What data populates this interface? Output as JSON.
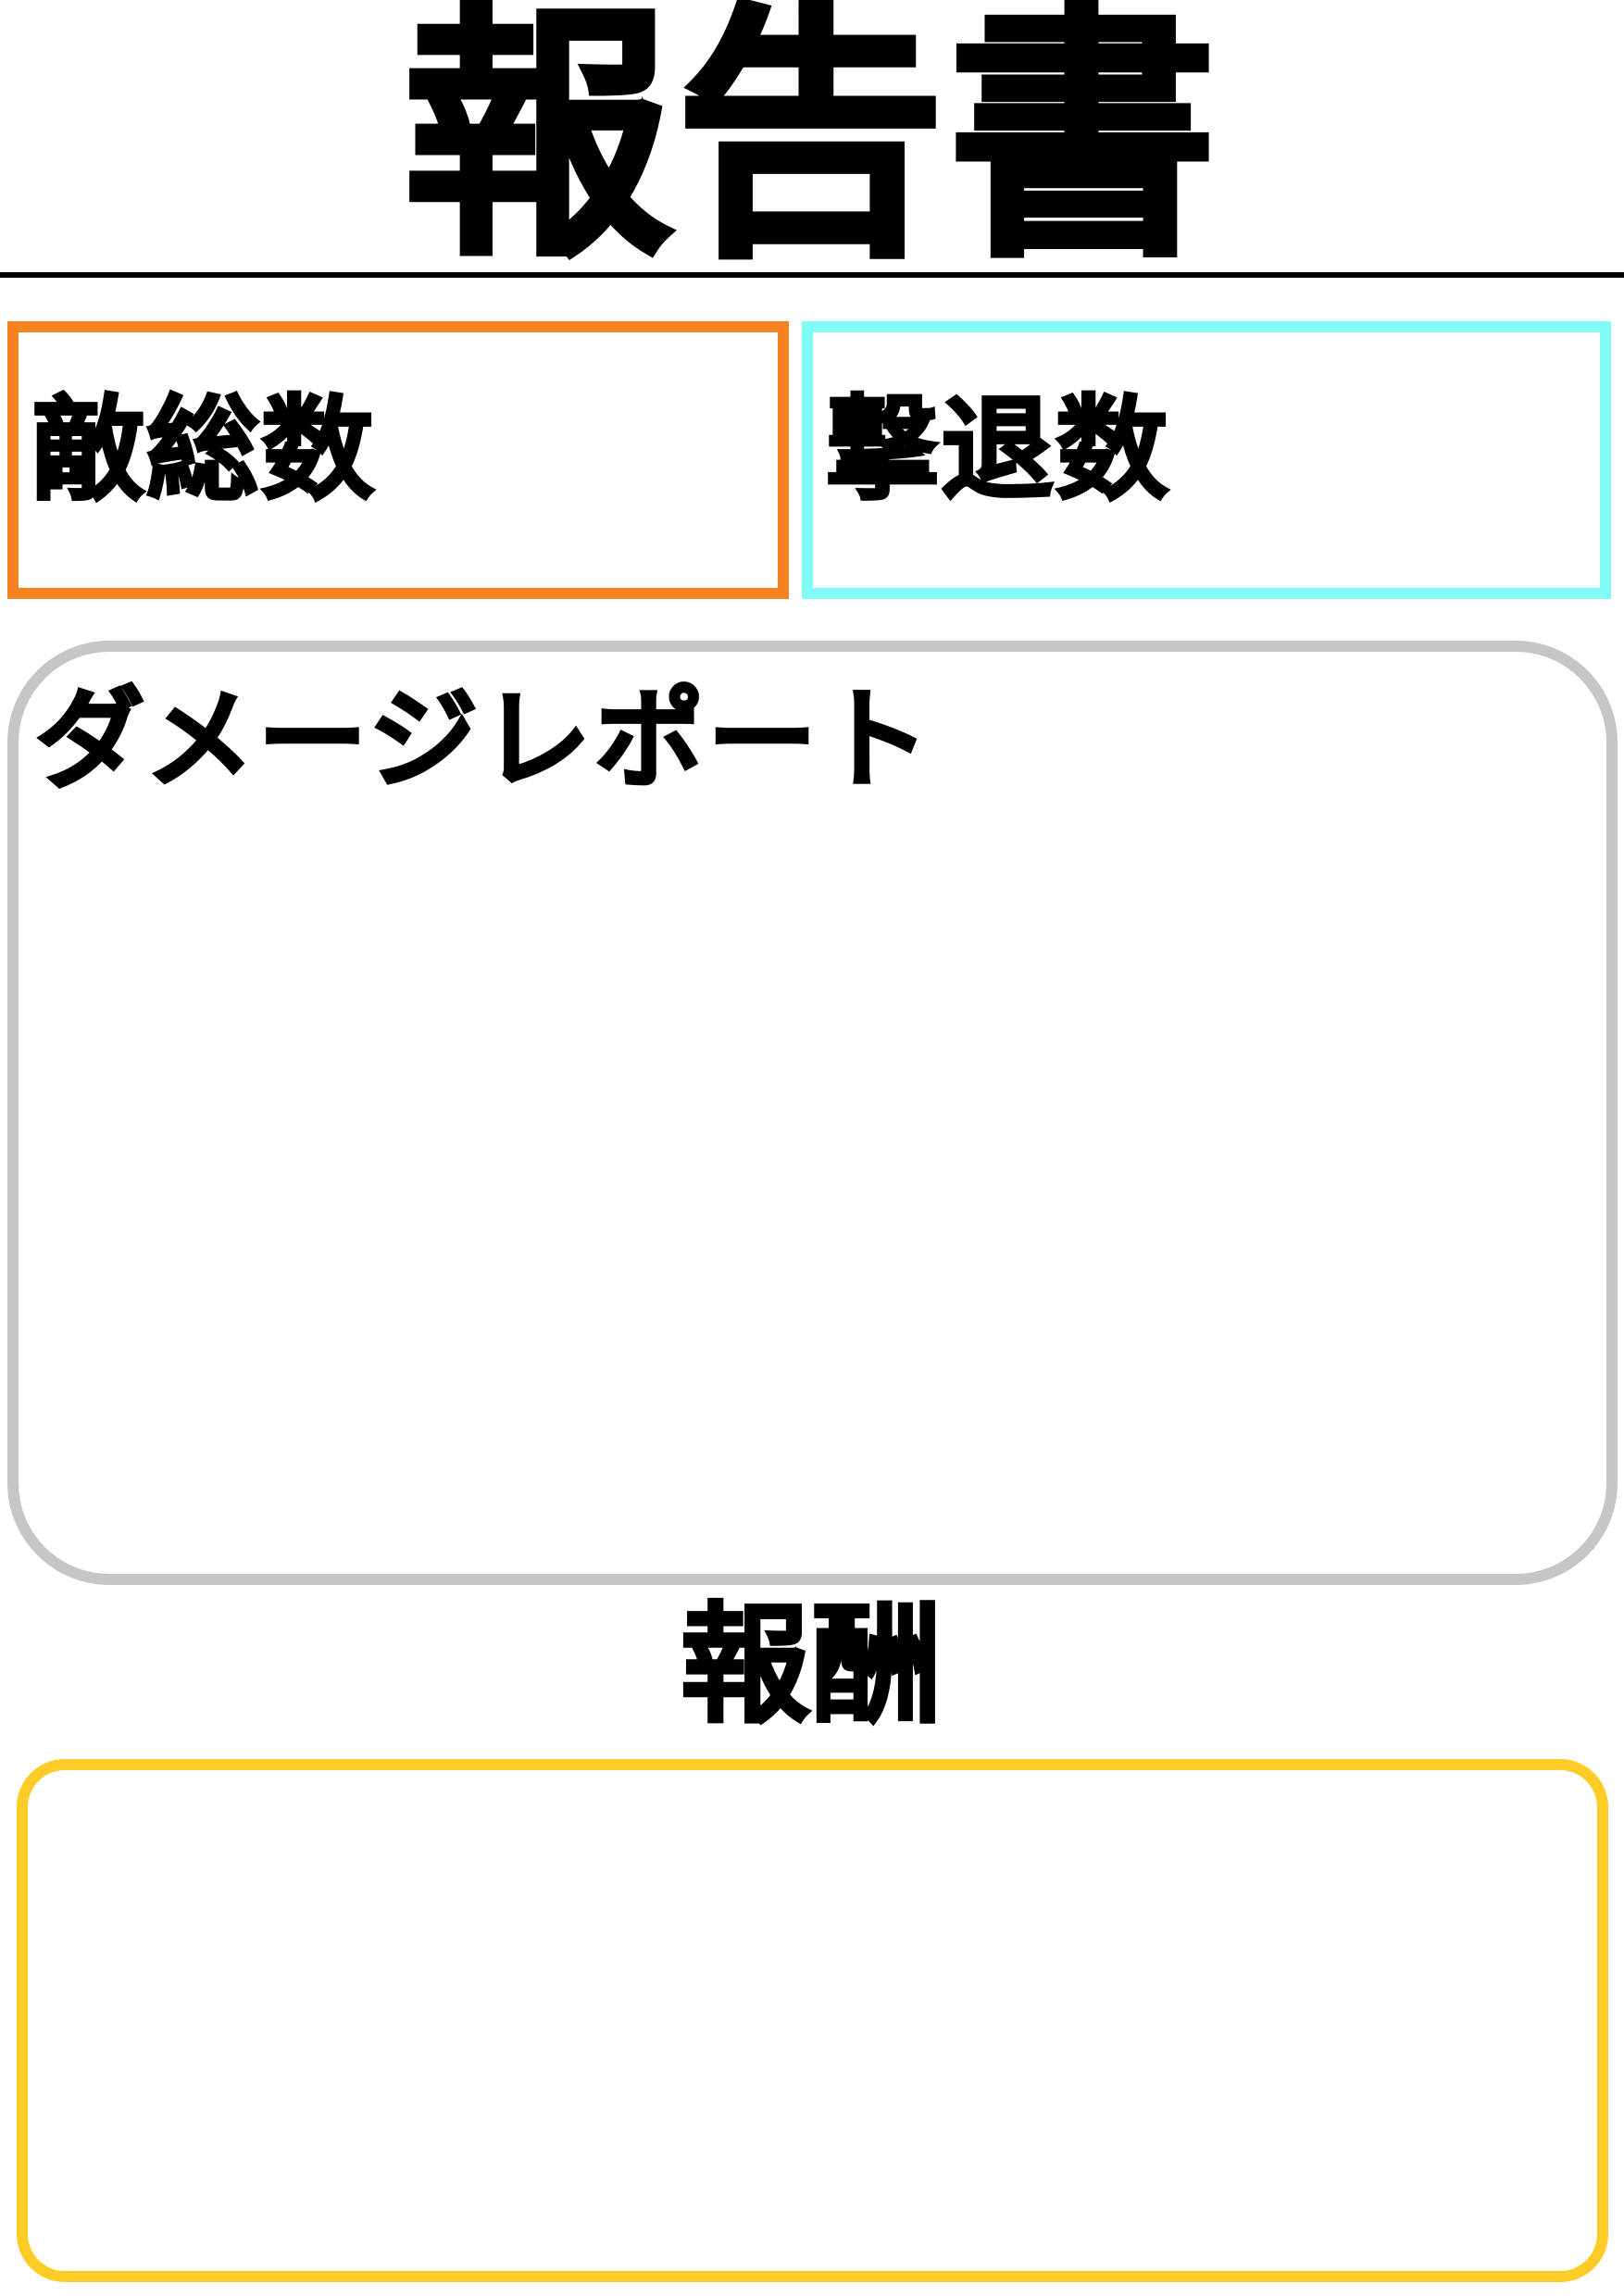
{
  "document": {
    "title": "報告書"
  },
  "sections": {
    "enemy_total": {
      "label": "敵総数",
      "border_color": "#f58220"
    },
    "defeated_count": {
      "label": "撃退数",
      "border_color": "#80fbf8"
    },
    "damage_report": {
      "label": "ダメージレポート",
      "border_color": "#c6c6c6"
    },
    "reward": {
      "label": "報酬",
      "border_color": "#fecb27"
    }
  }
}
